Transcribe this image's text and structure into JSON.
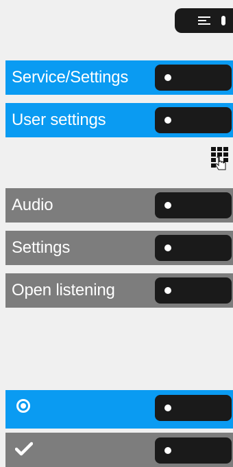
{
  "menu_key": {
    "icon": "menu-lines-icon"
  },
  "rows": [
    {
      "label": "Service/Settings",
      "style": "blue"
    },
    {
      "label": "User settings",
      "style": "blue"
    },
    {
      "label": "Audio",
      "style": "gray"
    },
    {
      "label": "Settings",
      "style": "gray"
    },
    {
      "label": "Open listening",
      "style": "gray"
    },
    {
      "icon": "radio-selected-icon",
      "style": "blue"
    },
    {
      "icon": "checkmark-icon",
      "style": "gray"
    }
  ],
  "keypad_hint": {
    "icon": "keypad-touch-icon"
  },
  "colors": {
    "blue": "#0a9bf2",
    "gray": "#7d7d7d",
    "key": "#1a1a1a",
    "background": "#f0f0f0"
  }
}
